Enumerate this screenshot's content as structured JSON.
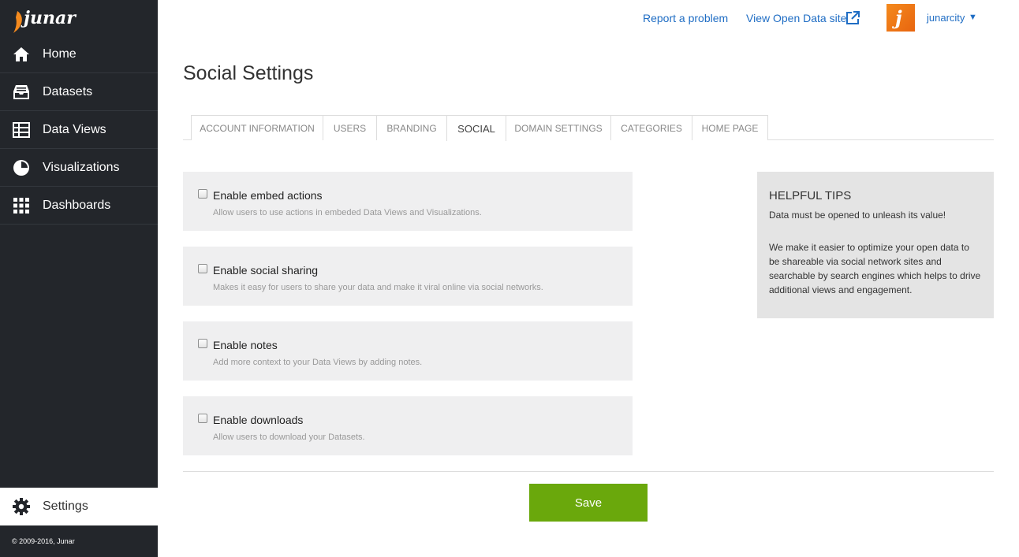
{
  "app": {
    "logo_text": "junar",
    "copyright": "© 2009-2016, Junar"
  },
  "sidebar": {
    "items": [
      {
        "label": "Home",
        "icon": "home-icon"
      },
      {
        "label": "Datasets",
        "icon": "inbox-tray-icon"
      },
      {
        "label": "Data Views",
        "icon": "table-icon"
      },
      {
        "label": "Visualizations",
        "icon": "pie-chart-icon"
      },
      {
        "label": "Dashboards",
        "icon": "grid-icon"
      }
    ],
    "settings": {
      "label": "Settings",
      "icon": "gear-icon"
    }
  },
  "header": {
    "report_link": "Report a problem",
    "view_site_link": "View Open Data site",
    "username": "junarcity",
    "avatar_letter": "j"
  },
  "page": {
    "title": "Social Settings"
  },
  "tabs": [
    {
      "label": "ACCOUNT INFORMATION",
      "active": false
    },
    {
      "label": "USERS",
      "active": false
    },
    {
      "label": "BRANDING",
      "active": false
    },
    {
      "label": "SOCIAL",
      "active": true
    },
    {
      "label": "DOMAIN SETTINGS",
      "active": false
    },
    {
      "label": "CATEGORIES",
      "active": false
    },
    {
      "label": "HOME PAGE",
      "active": false
    }
  ],
  "options": [
    {
      "title": "Enable embed actions",
      "description": "Allow users to use actions in embeded Data Views and Visualizations.",
      "checked": false
    },
    {
      "title": "Enable social sharing",
      "description": "Makes it easy for users to share your data and make it viral online via social networks.",
      "checked": false
    },
    {
      "title": "Enable notes",
      "description": "Add more context to your Data Views by adding notes.",
      "checked": false
    },
    {
      "title": "Enable downloads",
      "description": "Allow users to download your Datasets.",
      "checked": false
    }
  ],
  "tips": {
    "heading": "HELPFUL TIPS",
    "line1": "Data must be opened to unleash its value!",
    "line2": "We make it easier to optimize your open data to be shareable via social network sites and searchable by search engines which helps to drive additional views and engagement."
  },
  "actions": {
    "save_label": "Save"
  },
  "colors": {
    "sidebar_bg": "#23262b",
    "link": "#1f6dc4",
    "save_button": "#6aa80c",
    "brand_orange": "#f48a1e"
  }
}
